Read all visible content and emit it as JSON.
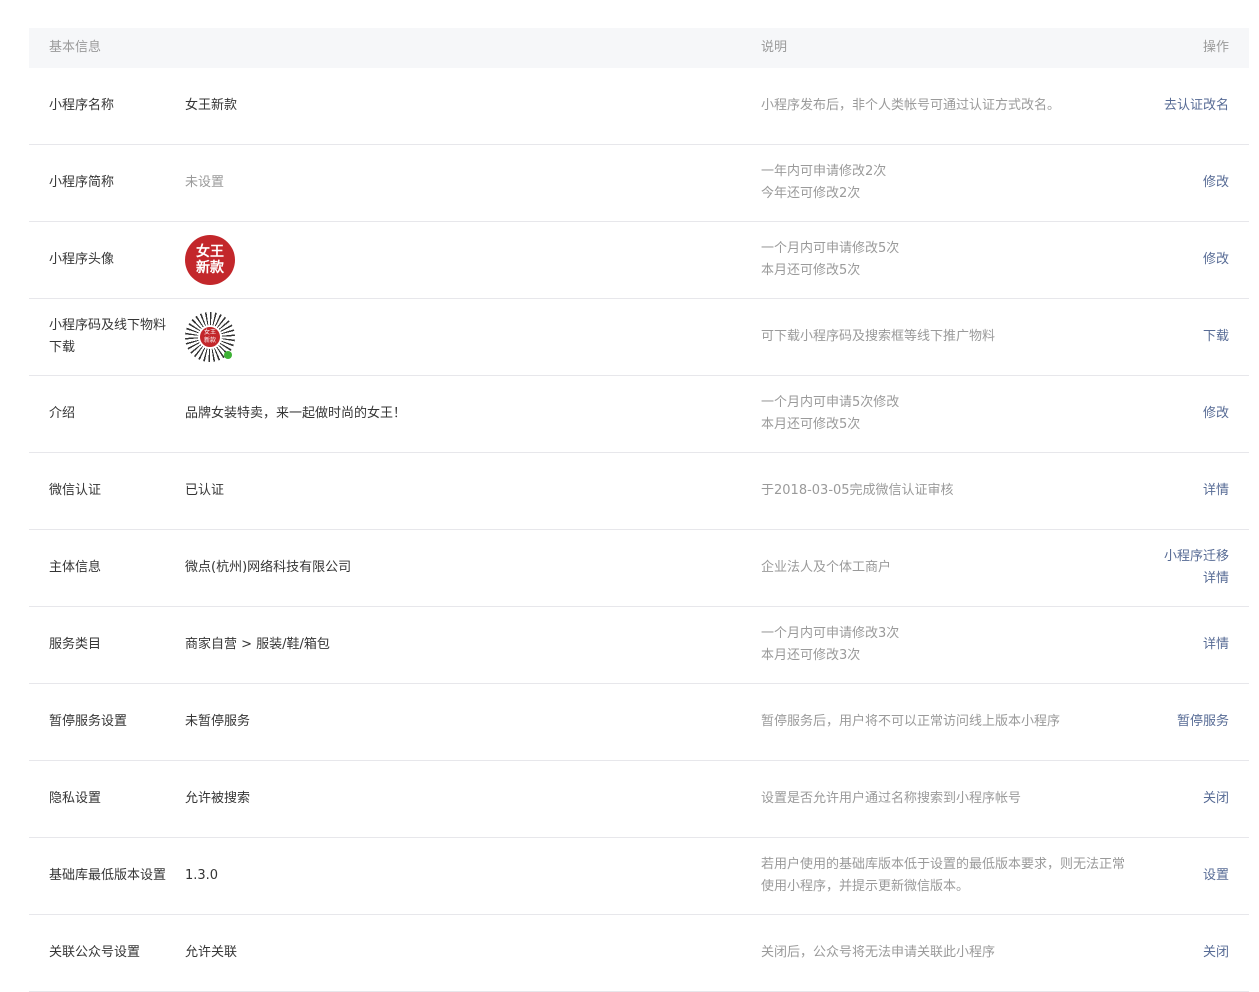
{
  "header": {
    "basic": "基本信息",
    "desc": "说明",
    "ops": "操作"
  },
  "avatar_text": [
    "女王",
    "新款"
  ],
  "rows": [
    {
      "label": "小程序名称",
      "value": "女王新款",
      "desc": [
        "小程序发布后，非个人类帐号可通过认证方式改名。"
      ],
      "actions": [
        "去认证改名"
      ]
    },
    {
      "label": "小程序简称",
      "value": "未设置",
      "muted": true,
      "desc": [
        "一年内可申请修改2次",
        "今年还可修改2次"
      ],
      "actions": [
        "修改"
      ]
    },
    {
      "label": "小程序头像",
      "value": "",
      "desc": [
        "一个月内可申请修改5次",
        "本月还可修改5次"
      ],
      "actions": [
        "修改"
      ]
    },
    {
      "label": "小程序码及线下物料下载",
      "value": "",
      "desc": [
        "可下载小程序码及搜索框等线下推广物料"
      ],
      "actions": [
        "下载"
      ]
    },
    {
      "label": "介绍",
      "value": "品牌女装特卖，来一起做时尚的女王！",
      "desc": [
        "一个月内可申请5次修改",
        "本月还可修改5次"
      ],
      "actions": [
        "修改"
      ]
    },
    {
      "label": "微信认证",
      "value": "已认证",
      "desc": [
        "于2018-03-05完成微信认证审核"
      ],
      "actions": [
        "详情"
      ]
    },
    {
      "label": "主体信息",
      "value": "微点(杭州)网络科技有限公司",
      "desc": [
        "企业法人及个体工商户"
      ],
      "actions": [
        "小程序迁移",
        "详情"
      ]
    },
    {
      "label": "服务类目",
      "value": "商家自营 > 服装/鞋/箱包",
      "desc": [
        "一个月内可申请修改3次",
        "本月还可修改3次"
      ],
      "actions": [
        "详情"
      ]
    },
    {
      "label": "暂停服务设置",
      "value": "未暂停服务",
      "desc": [
        "暂停服务后，用户将不可以正常访问线上版本小程序"
      ],
      "actions": [
        "暂停服务"
      ]
    },
    {
      "label": "隐私设置",
      "value": "允许被搜索",
      "desc": [
        "设置是否允许用户通过名称搜索到小程序帐号"
      ],
      "actions": [
        "关闭"
      ]
    },
    {
      "label": "基础库最低版本设置",
      "value": "1.3.0",
      "desc": [
        "若用户使用的基础库版本低于设置的最低版本要求，则无法正常使用小程序，并提示更新微信版本。"
      ],
      "actions": [
        "设置"
      ]
    },
    {
      "label": "关联公众号设置",
      "value": "允许关联",
      "desc": [
        "关闭后，公众号将无法申请关联此小程序"
      ],
      "actions": [
        "关闭"
      ]
    }
  ]
}
